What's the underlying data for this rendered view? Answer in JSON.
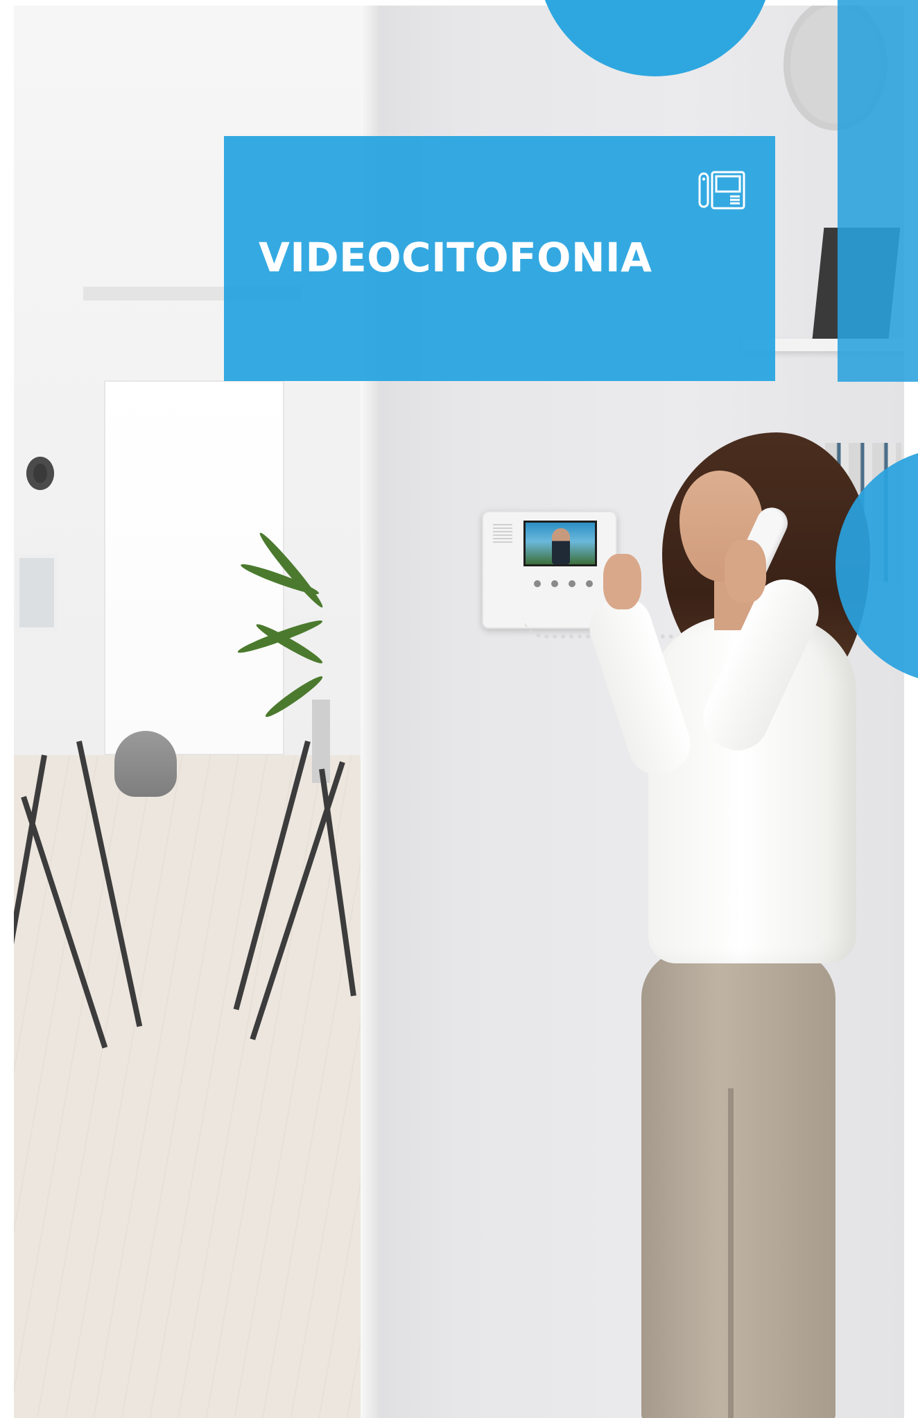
{
  "title": "VIDEOCITOFONIA",
  "icon": "video-intercom-icon",
  "colors": {
    "accent_blue": "#26A4E0",
    "title_text": "#FFFFFF",
    "background": "#FFFFFF"
  }
}
